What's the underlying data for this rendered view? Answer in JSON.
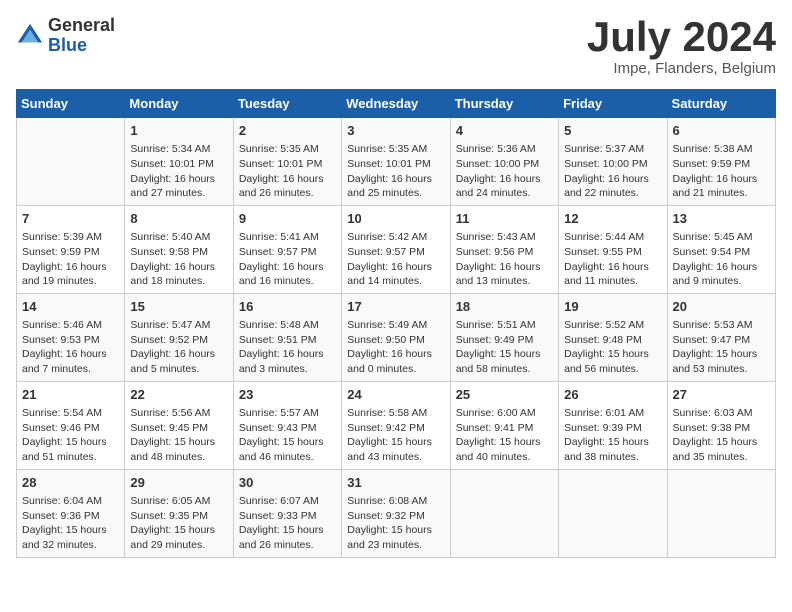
{
  "header": {
    "logo_general": "General",
    "logo_blue": "Blue",
    "title": "July 2024",
    "subtitle": "Impe, Flanders, Belgium"
  },
  "weekdays": [
    "Sunday",
    "Monday",
    "Tuesday",
    "Wednesday",
    "Thursday",
    "Friday",
    "Saturday"
  ],
  "weeks": [
    [
      {
        "day": "",
        "content": ""
      },
      {
        "day": "1",
        "content": "Sunrise: 5:34 AM\nSunset: 10:01 PM\nDaylight: 16 hours\nand 27 minutes."
      },
      {
        "day": "2",
        "content": "Sunrise: 5:35 AM\nSunset: 10:01 PM\nDaylight: 16 hours\nand 26 minutes."
      },
      {
        "day": "3",
        "content": "Sunrise: 5:35 AM\nSunset: 10:01 PM\nDaylight: 16 hours\nand 25 minutes."
      },
      {
        "day": "4",
        "content": "Sunrise: 5:36 AM\nSunset: 10:00 PM\nDaylight: 16 hours\nand 24 minutes."
      },
      {
        "day": "5",
        "content": "Sunrise: 5:37 AM\nSunset: 10:00 PM\nDaylight: 16 hours\nand 22 minutes."
      },
      {
        "day": "6",
        "content": "Sunrise: 5:38 AM\nSunset: 9:59 PM\nDaylight: 16 hours\nand 21 minutes."
      }
    ],
    [
      {
        "day": "7",
        "content": "Sunrise: 5:39 AM\nSunset: 9:59 PM\nDaylight: 16 hours\nand 19 minutes."
      },
      {
        "day": "8",
        "content": "Sunrise: 5:40 AM\nSunset: 9:58 PM\nDaylight: 16 hours\nand 18 minutes."
      },
      {
        "day": "9",
        "content": "Sunrise: 5:41 AM\nSunset: 9:57 PM\nDaylight: 16 hours\nand 16 minutes."
      },
      {
        "day": "10",
        "content": "Sunrise: 5:42 AM\nSunset: 9:57 PM\nDaylight: 16 hours\nand 14 minutes."
      },
      {
        "day": "11",
        "content": "Sunrise: 5:43 AM\nSunset: 9:56 PM\nDaylight: 16 hours\nand 13 minutes."
      },
      {
        "day": "12",
        "content": "Sunrise: 5:44 AM\nSunset: 9:55 PM\nDaylight: 16 hours\nand 11 minutes."
      },
      {
        "day": "13",
        "content": "Sunrise: 5:45 AM\nSunset: 9:54 PM\nDaylight: 16 hours\nand 9 minutes."
      }
    ],
    [
      {
        "day": "14",
        "content": "Sunrise: 5:46 AM\nSunset: 9:53 PM\nDaylight: 16 hours\nand 7 minutes."
      },
      {
        "day": "15",
        "content": "Sunrise: 5:47 AM\nSunset: 9:52 PM\nDaylight: 16 hours\nand 5 minutes."
      },
      {
        "day": "16",
        "content": "Sunrise: 5:48 AM\nSunset: 9:51 PM\nDaylight: 16 hours\nand 3 minutes."
      },
      {
        "day": "17",
        "content": "Sunrise: 5:49 AM\nSunset: 9:50 PM\nDaylight: 16 hours\nand 0 minutes."
      },
      {
        "day": "18",
        "content": "Sunrise: 5:51 AM\nSunset: 9:49 PM\nDaylight: 15 hours\nand 58 minutes."
      },
      {
        "day": "19",
        "content": "Sunrise: 5:52 AM\nSunset: 9:48 PM\nDaylight: 15 hours\nand 56 minutes."
      },
      {
        "day": "20",
        "content": "Sunrise: 5:53 AM\nSunset: 9:47 PM\nDaylight: 15 hours\nand 53 minutes."
      }
    ],
    [
      {
        "day": "21",
        "content": "Sunrise: 5:54 AM\nSunset: 9:46 PM\nDaylight: 15 hours\nand 51 minutes."
      },
      {
        "day": "22",
        "content": "Sunrise: 5:56 AM\nSunset: 9:45 PM\nDaylight: 15 hours\nand 48 minutes."
      },
      {
        "day": "23",
        "content": "Sunrise: 5:57 AM\nSunset: 9:43 PM\nDaylight: 15 hours\nand 46 minutes."
      },
      {
        "day": "24",
        "content": "Sunrise: 5:58 AM\nSunset: 9:42 PM\nDaylight: 15 hours\nand 43 minutes."
      },
      {
        "day": "25",
        "content": "Sunrise: 6:00 AM\nSunset: 9:41 PM\nDaylight: 15 hours\nand 40 minutes."
      },
      {
        "day": "26",
        "content": "Sunrise: 6:01 AM\nSunset: 9:39 PM\nDaylight: 15 hours\nand 38 minutes."
      },
      {
        "day": "27",
        "content": "Sunrise: 6:03 AM\nSunset: 9:38 PM\nDaylight: 15 hours\nand 35 minutes."
      }
    ],
    [
      {
        "day": "28",
        "content": "Sunrise: 6:04 AM\nSunset: 9:36 PM\nDaylight: 15 hours\nand 32 minutes."
      },
      {
        "day": "29",
        "content": "Sunrise: 6:05 AM\nSunset: 9:35 PM\nDaylight: 15 hours\nand 29 minutes."
      },
      {
        "day": "30",
        "content": "Sunrise: 6:07 AM\nSunset: 9:33 PM\nDaylight: 15 hours\nand 26 minutes."
      },
      {
        "day": "31",
        "content": "Sunrise: 6:08 AM\nSunset: 9:32 PM\nDaylight: 15 hours\nand 23 minutes."
      },
      {
        "day": "",
        "content": ""
      },
      {
        "day": "",
        "content": ""
      },
      {
        "day": "",
        "content": ""
      }
    ]
  ]
}
